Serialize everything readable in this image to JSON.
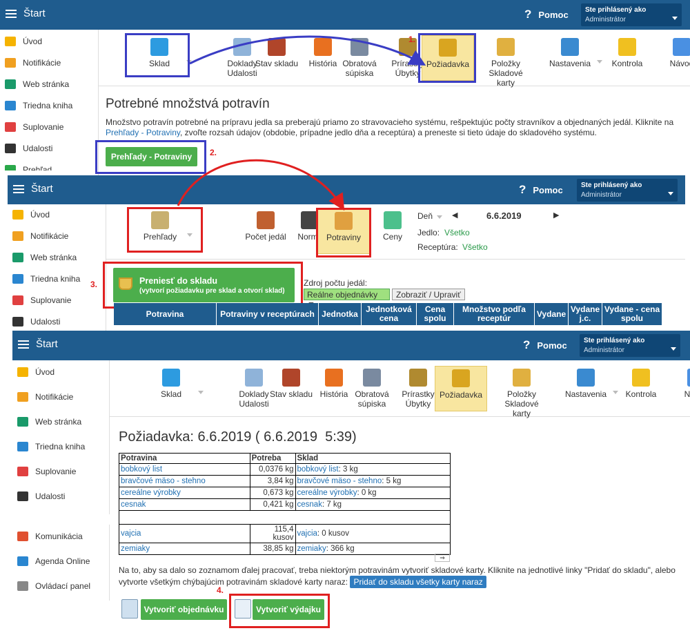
{
  "app": {
    "title": "Štart",
    "help": "Pomoc",
    "user_label": "Ste prihlásený ako",
    "user_name": "Administrátor"
  },
  "sidebar": {
    "items": [
      {
        "label": "Úvod",
        "icon": "star-icon",
        "color": "#f5b301"
      },
      {
        "label": "Notifikácie",
        "icon": "envelope-icon",
        "color": "#f0a020"
      },
      {
        "label": "Web stránka",
        "icon": "home-icon",
        "color": "#1a9a6a"
      },
      {
        "label": "Triedna kniha",
        "icon": "book-icon",
        "color": "#2a86d0"
      },
      {
        "label": "Suplovanie",
        "icon": "person-icon",
        "color": "#e04040"
      },
      {
        "label": "Udalosti",
        "icon": "calendar-icon",
        "color": "#333333"
      }
    ],
    "partial": "Prehľad",
    "extra": [
      {
        "label": "Komunikácia",
        "icon": "chat-icon",
        "color": "#e05030"
      },
      {
        "label": "Agenda Online",
        "icon": "leaf-icon",
        "color": "#2a86d0"
      },
      {
        "label": "Ovládací panel",
        "icon": "gear-icon",
        "color": "#888888"
      }
    ]
  },
  "toolbar1": {
    "items": [
      "Sklad",
      "Doklady Udalosti",
      "Stav skladu",
      "História",
      "Obratová súpiska",
      "Prírastky Úbytky",
      "Požiadavka",
      "Položky Skladové karty",
      "Nastavenia",
      "Kontrola",
      "Návod"
    ]
  },
  "toolbar2": {
    "items": [
      "Prehľady",
      "Počet jedál",
      "Normy",
      "Potraviny",
      "Ceny"
    ],
    "filters": {
      "day_label": "Deň",
      "date": "6.6.2019",
      "meal_label": "Jedlo:",
      "meal_value": "Všetko",
      "recipe_label": "Receptúra:",
      "recipe_value": "Všetko"
    }
  },
  "section1": {
    "title": "Potrebné množstvá potravín",
    "desc_a": "Množstvo potravín potrebné na prípravu jedla sa preberajú priamo zo stravovacieho systému, rešpektujúc počty stravníkov a objednaných jedál. Kliknite na",
    "desc_link": "Prehľady - Potraviny",
    "desc_b": ", zvoľte rozsah údajov (obdobie, prípadne jedlo dňa a receptúra) a preneste si tieto údaje do skladového systému.",
    "button": "Prehľady - Potraviny"
  },
  "transfer": {
    "title": "Preniesť do skladu",
    "subtitle": "(vytvorí požiadavku pre sklad a otvorí sklad)",
    "source_label": "Zdroj počtu jedál:",
    "source_value": "Reálne objednávky",
    "show_button": "Zobraziť / Upraviť"
  },
  "grid_headers": [
    "Potravina",
    "Potraviny v receptúrach",
    "Jednotka",
    "Jednotková cena",
    "Cena spolu",
    "Množstvo podľa receptúr",
    "Vydane",
    "Vydane j.c.",
    "Vydane - cena spolu"
  ],
  "request": {
    "title": "Požiadavka: 6.6.2019 ( 6.6.2019  5:39)",
    "headers": [
      "Potravina",
      "Potreba",
      "Sklad"
    ],
    "rows": [
      {
        "name": "bobkový list",
        "need": "0,0376 kg",
        "stock_link": "bobkový list",
        "stock": ":  3 kg"
      },
      {
        "name": "bravčové mäso - stehno",
        "need": "3,84 kg",
        "stock_link": "bravčové mäso - stehno",
        "stock": ": 5 kg"
      },
      {
        "name": "cereálne výrobky",
        "need": "0,673 kg",
        "stock_link": "cereálne výrobky",
        "stock": ": 0 kg"
      },
      {
        "name": "cesnak",
        "need": "0,421 kg",
        "stock_link": "cesnak",
        "stock": ":  7 kg"
      },
      {
        "name": "vajcia",
        "need": "115,4 kusov",
        "stock_link": "vajcia",
        "stock": ": 0 kusov"
      },
      {
        "name": "zemiaky",
        "need": "38,85 kg",
        "stock_link": "zemiaky",
        "stock": ":  366 kg"
      }
    ],
    "note": "Na to, aby sa dalo so zoznamom ďalej pracovať, treba niektorým potravinám vytvoriť skladové karty. Kliknite na jednotlivé linky \"Pridať do skladu\", alebo vytvorte všetkým chýbajúcim potravinám skladové karty naraz:",
    "add_all": "Pridať do skladu všetky karty naraz",
    "order_button": "Vytvoriť objednávku",
    "issue_button": "Vytvoriť výdajku"
  },
  "steps": [
    "1.",
    "2.",
    "3.",
    "4."
  ],
  "colors": {
    "header": "#1f5c8e",
    "blue_box": "#3a3dc4",
    "red_box": "#e02020",
    "green": "#4cae4c"
  }
}
